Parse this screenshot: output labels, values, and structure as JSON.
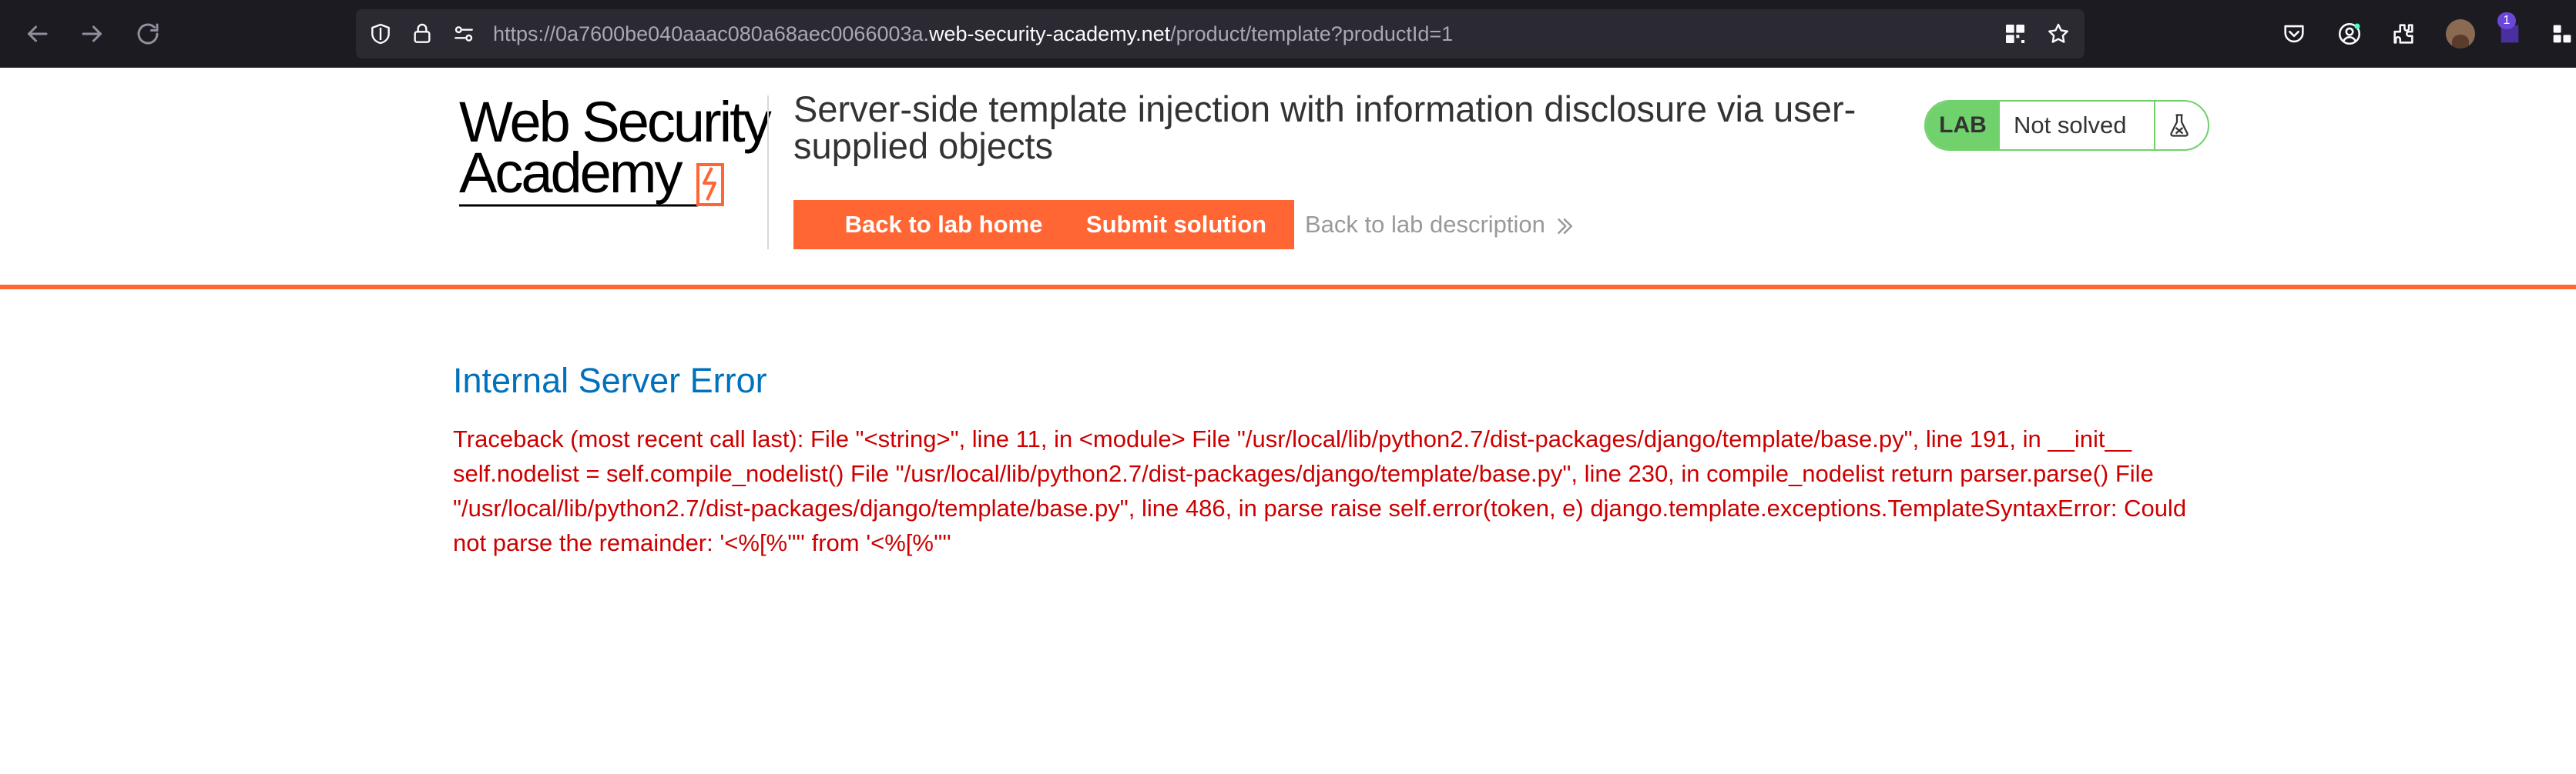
{
  "browser": {
    "url_prefix": "https://0a7600be040aaac080a68aec0066003a.",
    "url_domain": "web-security-academy.net",
    "url_path": "/product/template?productId=1",
    "icons": [
      "back-arrow-icon",
      "forward-arrow-icon",
      "reload-icon",
      "shield-icon",
      "lock-icon",
      "site-permissions-icon",
      "qr-code-icon",
      "bookmark-star-icon",
      "pocket-icon",
      "account-icon",
      "extensions-icon",
      "profile-avatar",
      "extension-badge-icon",
      "more-icon"
    ],
    "extension_badge": "1"
  },
  "header": {
    "logo_line1": "Web Security",
    "logo_line2": "Academy",
    "lab_title": "Server-side template injection with information disclosure via user-supplied objects",
    "back_to_lab_home": "Back to lab home",
    "submit_solution": "Submit solution",
    "back_to_lab_description": "Back to lab description",
    "lab_badge": "LAB",
    "lab_status": "Not solved"
  },
  "error": {
    "title": "Internal Server Error",
    "traceback": "Traceback (most recent call last): File \"<string>\", line 11, in <module> File \"/usr/local/lib/python2.7/dist-packages/django/template/base.py\", line 191, in __init__ self.nodelist = self.compile_nodelist() File \"/usr/local/lib/python2.7/dist-packages/django/template/base.py\", line 230, in compile_nodelist return parser.parse() File \"/usr/local/lib/python2.7/dist-packages/django/template/base.py\", line 486, in parse raise self.error(token, e) django.template.exceptions.TemplateSyntaxError: Could not parse the remainder: '<%[%'\"' from '<%[%'\"'"
  },
  "colors": {
    "accent_orange": "#ff6633",
    "status_green": "#70d16d",
    "error_blue": "#0071bc",
    "error_red": "#cc0000",
    "browser_toolbar": "#1c1b22"
  }
}
